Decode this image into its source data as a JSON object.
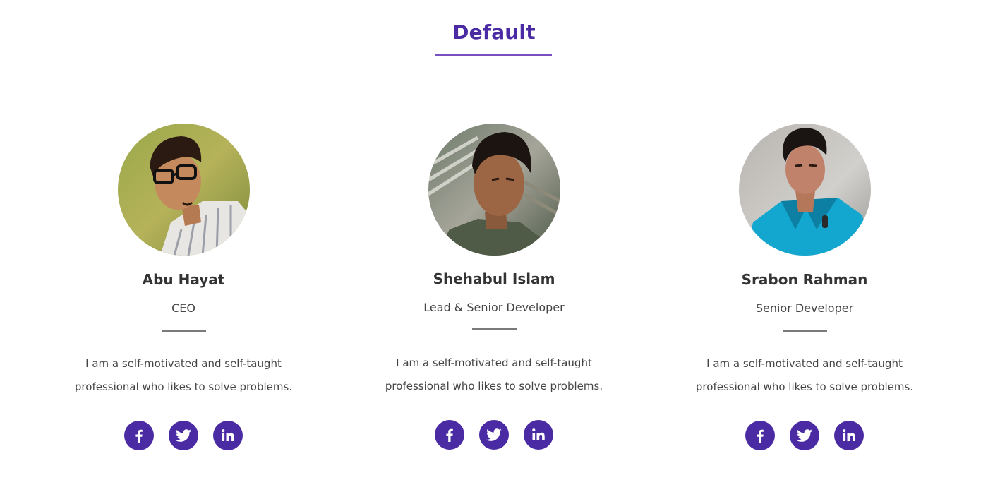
{
  "section": {
    "title": "Default"
  },
  "colors": {
    "accent": "#4a2ba3",
    "underline": "#7a4fc2",
    "divider": "#7a7a7a",
    "text": "#333333"
  },
  "members": [
    {
      "name": "Abu Hayat",
      "role": "CEO",
      "bio_line1": "I am a self-motivated and self-taught",
      "bio_line2": "professional who likes to solve problems.",
      "photo": "portrait-man-glasses-striped-shirt",
      "socials": [
        "facebook-icon",
        "twitter-icon",
        "linkedin-icon"
      ]
    },
    {
      "name": "Shehabul Islam",
      "role": "Lead & Senior Developer",
      "bio_line1": "I am a self-motivated and self-taught",
      "bio_line2": "professional who likes to solve problems.",
      "photo": "portrait-man-selfie-outdoor",
      "socials": [
        "facebook-icon",
        "twitter-icon",
        "linkedin-icon"
      ]
    },
    {
      "name": "Srabon Rahman",
      "role": "Senior Developer",
      "bio_line1": "I am a self-motivated and self-taught",
      "bio_line2": "professional who likes to solve problems.",
      "photo": "portrait-man-blue-shirt",
      "socials": [
        "facebook-icon",
        "twitter-icon",
        "linkedin-icon"
      ]
    }
  ]
}
